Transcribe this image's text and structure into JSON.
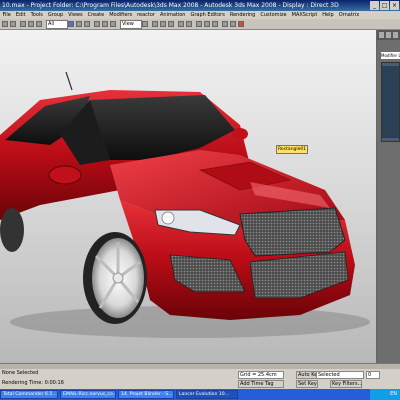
{
  "window": {
    "title": "10.max  -  Project Folder: C:\\Program Files\\Autodesk\\3ds Max 2008     -  Autodesk 3ds Max 2008     -  Display : Direct 3D",
    "buttons": [
      "_",
      "□",
      "×"
    ]
  },
  "menu": [
    "File",
    "Edit",
    "Tools",
    "Group",
    "Views",
    "Create",
    "Modifiers",
    "reactor",
    "Animation",
    "Graph Editors",
    "Rendering",
    "Customize",
    "MAXScript",
    "Help",
    "Ornatrix"
  ],
  "toolbar": {
    "selection_filter": "All",
    "ref_coord": "View"
  },
  "command_panel": {
    "modifier_list": "Modifier List"
  },
  "viewport": {
    "label": "",
    "tooltip": "Rectangle01"
  },
  "status": {
    "line1": "None Selected",
    "line2": "Rendering Time: 0:00:16",
    "grid": "Grid = 25.4cm",
    "auto_key": "Auto Key",
    "selected": "Selected",
    "set_key": "Set Key",
    "key_filters": "Key Filters...",
    "add_time_tag": "Add Time Tag",
    "frame": "0"
  },
  "taskbar": {
    "items": [
      {
        "label": "Total Commander 6.5..."
      },
      {
        "label": "EMAIL-Ricc.nervus_co..."
      },
      {
        "label": "14. Projet Blinder - S..."
      },
      {
        "label": "Lancer Evolution 10..."
      }
    ],
    "tray": "EN"
  },
  "colors": {
    "car_body": "#c8101a",
    "car_body_dark": "#7a050b",
    "viewport_bg": "#d8d8d8",
    "taskbar": "#245edb"
  },
  "icons": [
    "selection-icon",
    "move-icon",
    "rotate-icon",
    "scale-icon",
    "render-icon"
  ]
}
